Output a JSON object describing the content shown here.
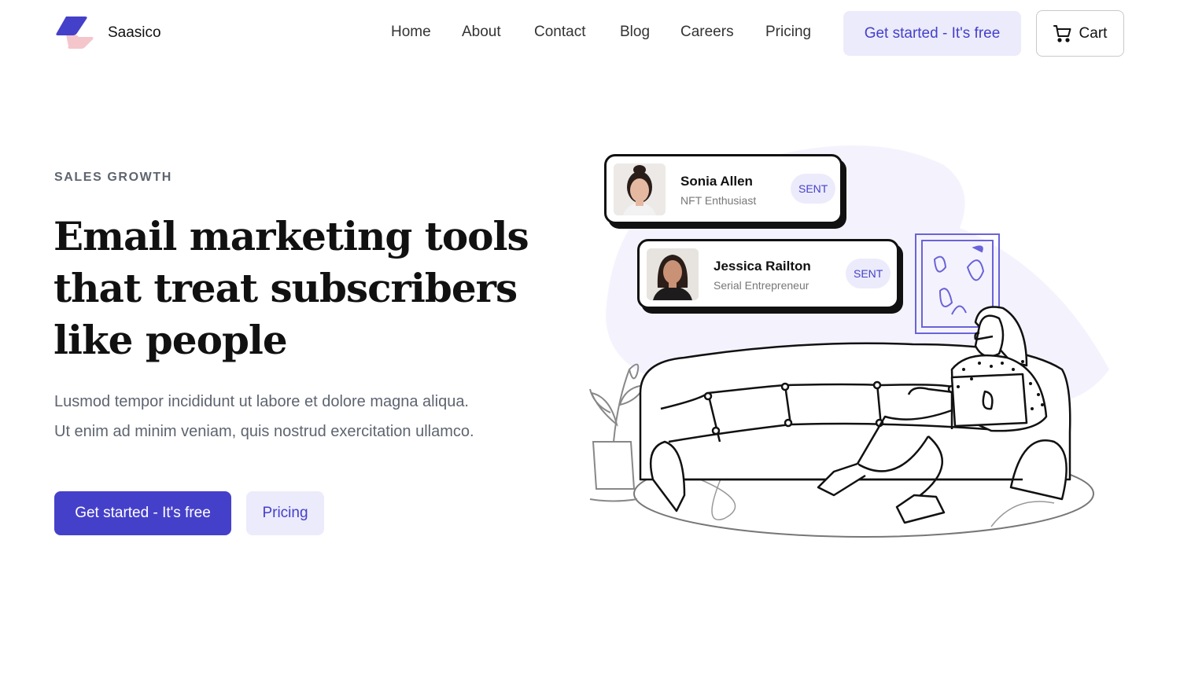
{
  "brand": {
    "name": "Saasico",
    "logo_icon": "logo-icon",
    "primary_color": "#4540c9",
    "accent_color": "#f4c6cb"
  },
  "nav": {
    "items": [
      {
        "label": "Home"
      },
      {
        "label": "About"
      },
      {
        "label": "Contact"
      },
      {
        "label": "Blog"
      },
      {
        "label": "Careers"
      },
      {
        "label": "Pricing"
      }
    ],
    "cta_label": "Get started - It's free",
    "cart_label": "Cart",
    "cart_icon": "cart-icon"
  },
  "hero": {
    "eyebrow": "SALES GROWTH",
    "headline": "Email marketing tools that treat subscribers like people",
    "subtext_line1": "Lusmod tempor incididunt ut labore et dolore magna aliqua.",
    "subtext_line2": "Ut enim ad minim veniam, quis nostrud exercitation ullamco.",
    "primary_button": "Get started - It's free",
    "secondary_button": "Pricing"
  },
  "cards": [
    {
      "name": "Sonia Allen",
      "role": "NFT Enthusiast",
      "status": "SENT"
    },
    {
      "name": "Jessica Railton",
      "role": "Serial Entrepreneur",
      "status": "SENT"
    }
  ]
}
